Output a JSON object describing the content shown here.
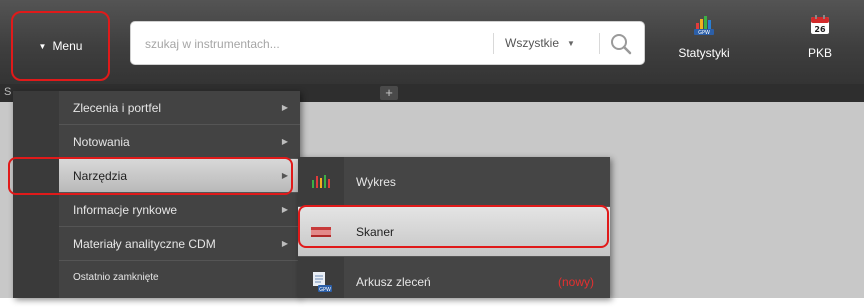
{
  "topbar": {
    "menu_label": "Menu",
    "search": {
      "placeholder": "szukaj w instrumentach...",
      "filter_value": "Wszystkie"
    },
    "tools": [
      {
        "label": "Statystyki",
        "icon": "statistics-gpw-icon"
      },
      {
        "label": "PKB",
        "icon": "calendar-26-icon"
      }
    ]
  },
  "tabs": {
    "stub_label": "S",
    "add_label": "+"
  },
  "main_menu": {
    "items": [
      {
        "label": "Zlecenia i portfel",
        "has_submenu": true,
        "active": false
      },
      {
        "label": "Notowania",
        "has_submenu": true,
        "active": false
      },
      {
        "label": "Narzędzia",
        "has_submenu": true,
        "active": true
      },
      {
        "label": "Informacje rynkowe",
        "has_submenu": true,
        "active": false
      },
      {
        "label": "Materiały analityczne CDM",
        "has_submenu": true,
        "active": false
      },
      {
        "label": "Ostatnio zamknięte",
        "has_submenu": false,
        "active": false
      }
    ]
  },
  "sub_menu": {
    "items": [
      {
        "label": "Wykres",
        "icon": "chart-icon",
        "active": false
      },
      {
        "label": "Skaner",
        "icon": "scanner-icon",
        "active": true
      },
      {
        "label": "Arkusz zleceń",
        "icon": "gpw-document-icon",
        "badge": "(nowy)",
        "active": false
      }
    ]
  },
  "colors": {
    "highlight": "#e01a1a",
    "badge": "#e53030",
    "topbar": "#3f3f3f",
    "menu_bg": "#434343"
  }
}
